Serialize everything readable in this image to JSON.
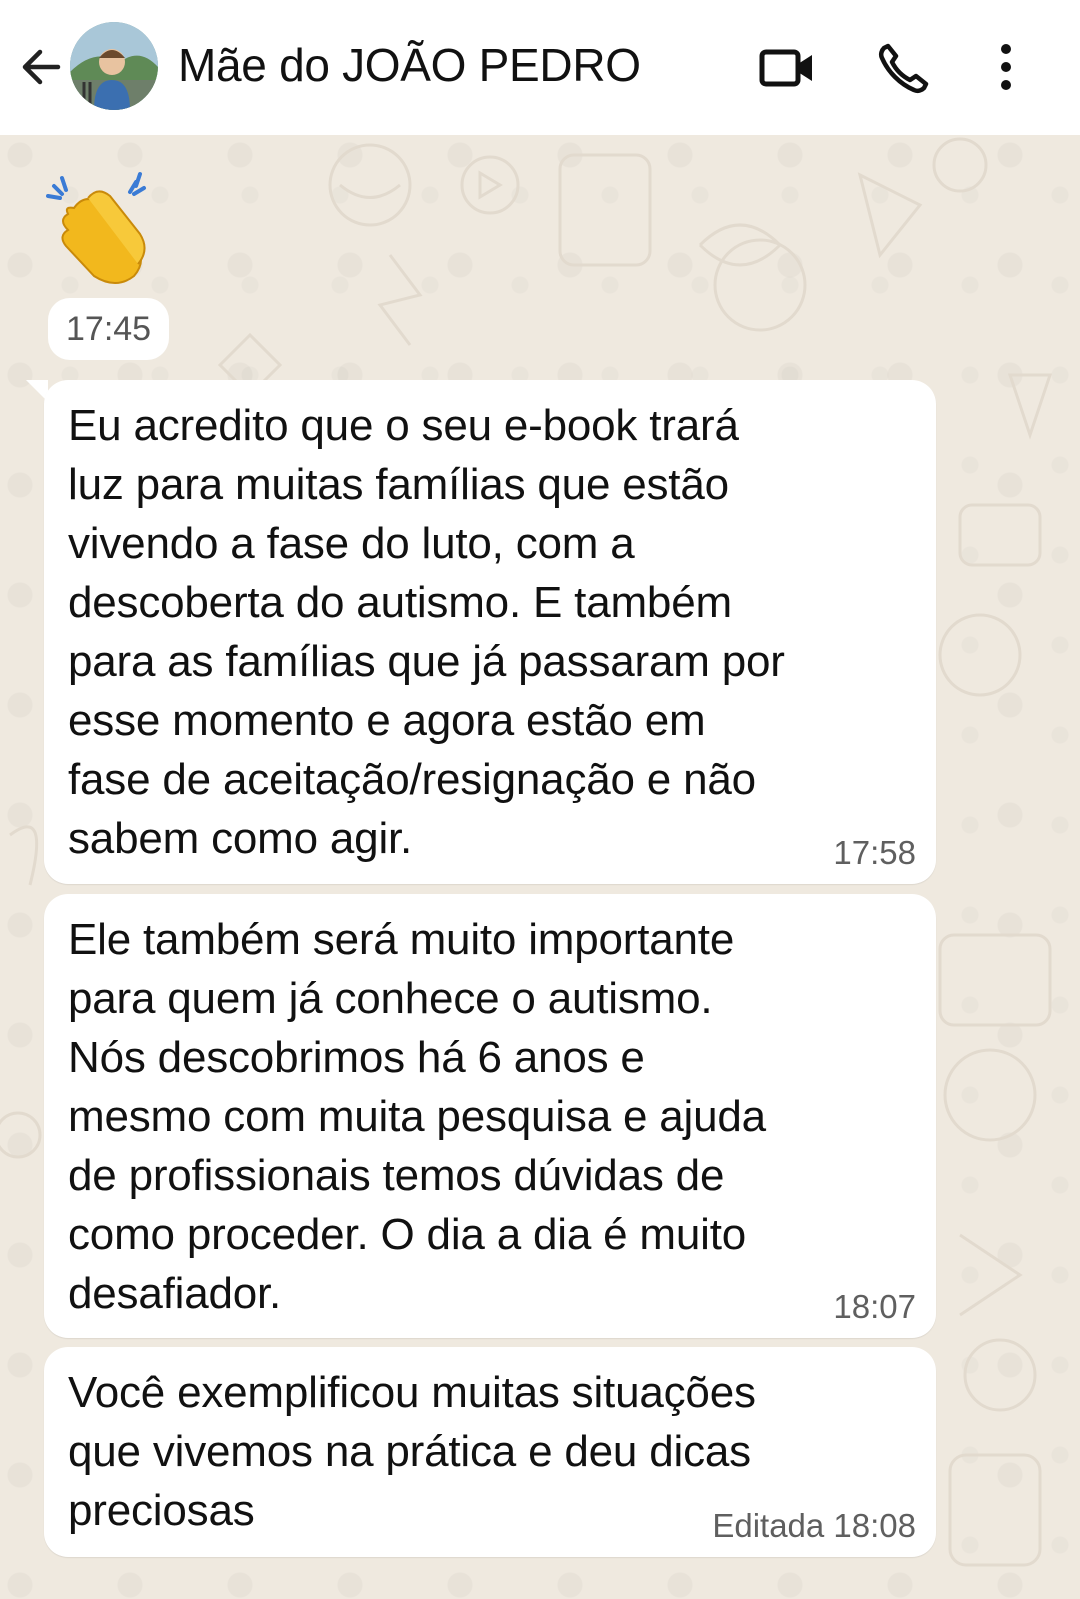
{
  "header": {
    "contact_name": "Mãe do JOÃO PEDRO"
  },
  "messages": [
    {
      "type": "emoji",
      "emoji": "👏",
      "time": "17:45"
    },
    {
      "type": "text",
      "text": "Eu acredito que o seu e-book trará\nluz para muitas famílias que estão\nvivendo a fase do luto, com a\ndescoberta do autismo. E também\npara as famílias que já passaram por\nesse momento e agora estão em\nfase de aceitação/resignação e não\nsabem como agir.",
      "time": "17:58"
    },
    {
      "type": "text",
      "text": "Ele também será muito importante\npara quem já conhece o autismo.\nNós descobrimos há 6 anos e\nmesmo com muita pesquisa e ajuda\nde profissionais temos dúvidas de\ncomo proceder. O dia a dia é muito\ndesafiador.",
      "time": "18:07"
    },
    {
      "type": "text",
      "text": "Você exemplificou muitas situações\nque vivemos na prática e deu dicas\npreciosas",
      "time": "Editada 18:08"
    }
  ],
  "colors": {
    "header_bg": "#ffffff",
    "chat_bg": "#efe9df",
    "bubble_bg": "#ffffff",
    "time_text": "#5f5f5f"
  },
  "icons": [
    "back-arrow-icon",
    "video-call-icon",
    "phone-icon",
    "more-options-icon"
  ]
}
